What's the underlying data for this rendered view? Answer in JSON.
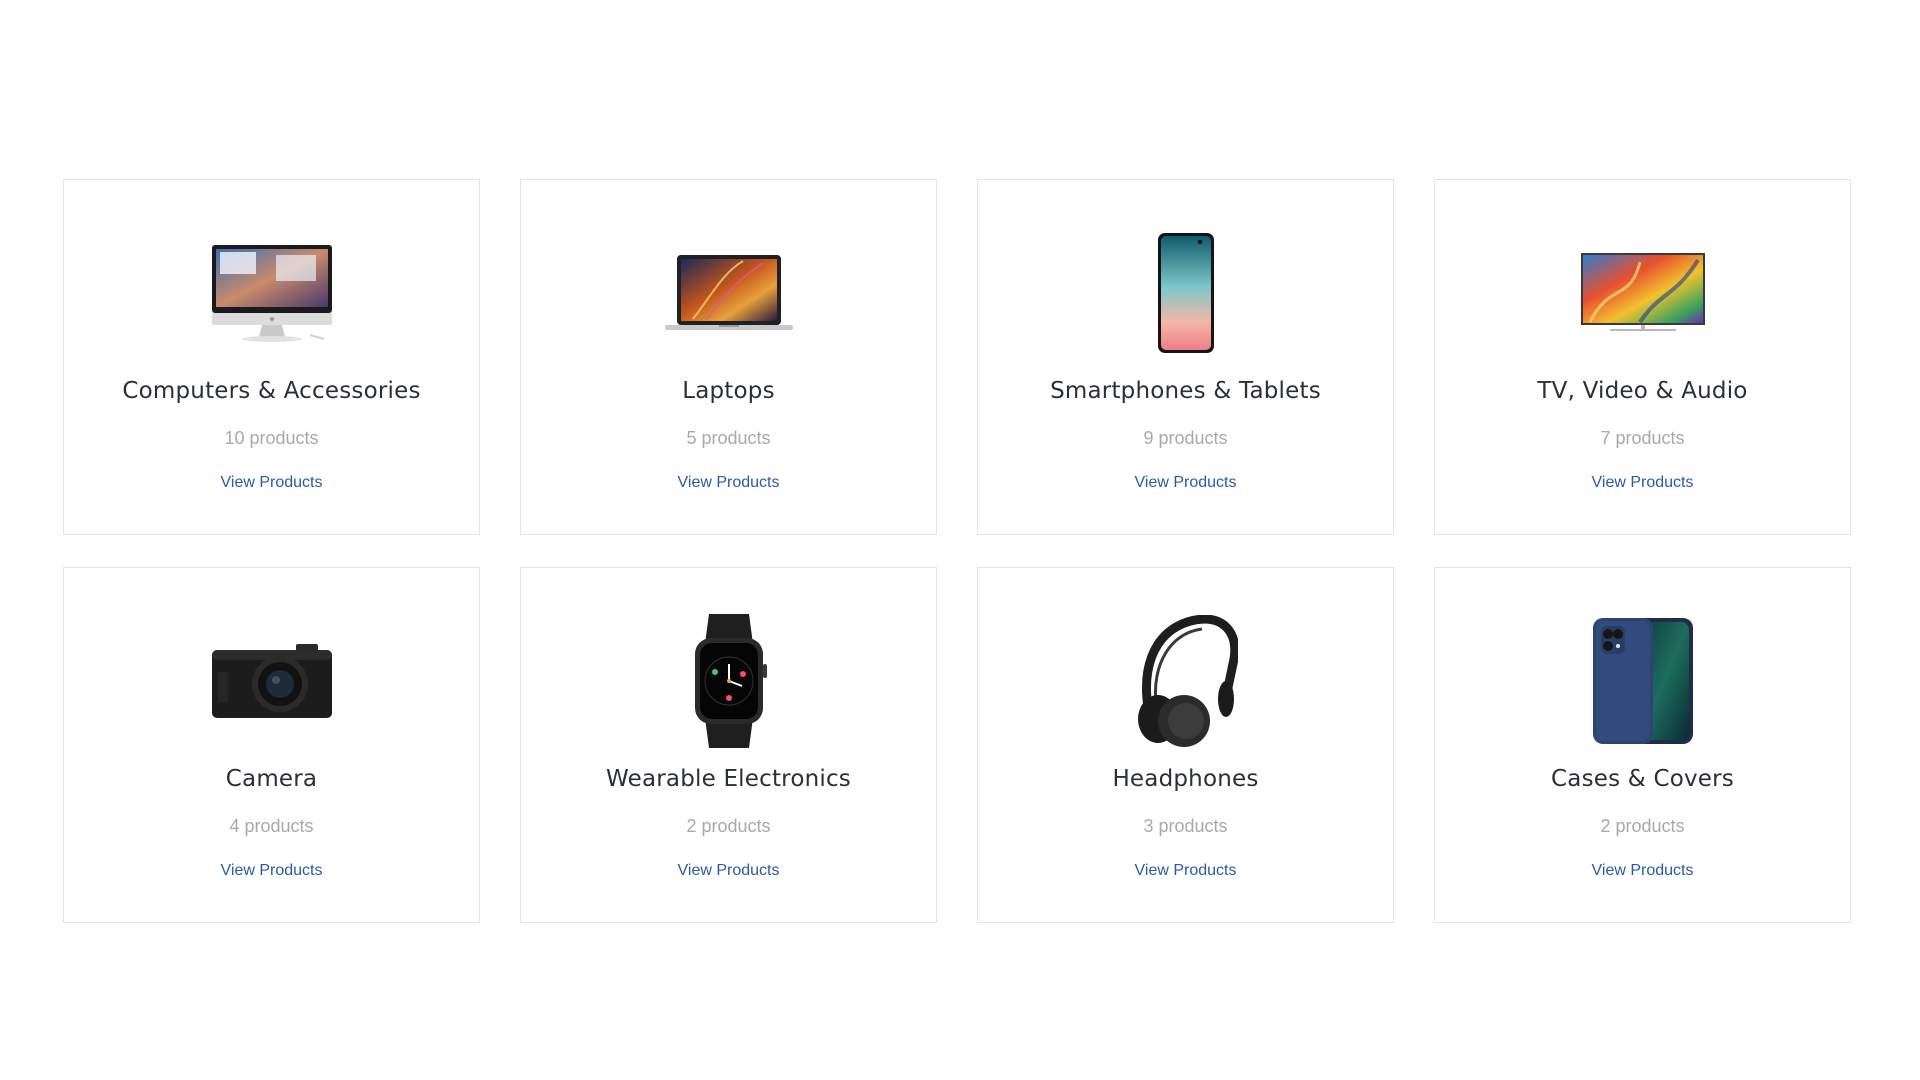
{
  "categories": [
    {
      "title": "Computers & Accessories",
      "count": "10 products",
      "link": "View Products",
      "icon": "imac-icon"
    },
    {
      "title": "Laptops",
      "count": "5 products",
      "link": "View Products",
      "icon": "laptop-icon"
    },
    {
      "title": "Smartphones & Tablets",
      "count": "9 products",
      "link": "View Products",
      "icon": "smartphone-icon"
    },
    {
      "title": "TV, Video & Audio",
      "count": "7 products",
      "link": "View Products",
      "icon": "tv-icon"
    },
    {
      "title": "Camera",
      "count": "4 products",
      "link": "View Products",
      "icon": "camera-icon"
    },
    {
      "title": "Wearable Electronics",
      "count": "2 products",
      "link": "View Products",
      "icon": "smartwatch-icon"
    },
    {
      "title": "Headphones",
      "count": "3 products",
      "link": "View Products",
      "icon": "headphones-icon"
    },
    {
      "title": "Cases & Covers",
      "count": "2 products",
      "link": "View Products",
      "icon": "phone-case-icon"
    }
  ],
  "colors": {
    "title": "#2b2f36",
    "count": "#a9a9a9",
    "link": "#2c5aa8",
    "card_border": "#e4e4e4"
  }
}
